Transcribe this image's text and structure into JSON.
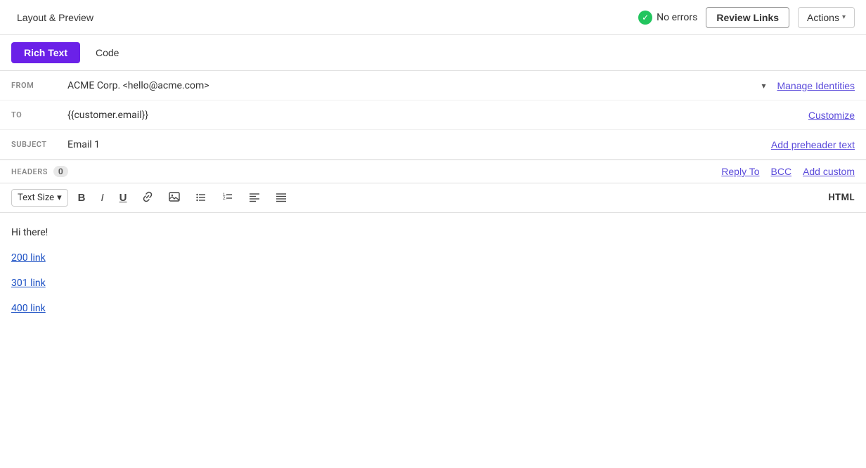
{
  "topbar": {
    "layout_preview_label": "Layout & Preview",
    "no_errors_label": "No errors",
    "review_links_label": "Review Links",
    "actions_label": "Actions"
  },
  "tabs": {
    "rich_text_label": "Rich Text",
    "code_label": "Code"
  },
  "from_field": {
    "label": "FROM",
    "value": "ACME Corp. <hello@acme.com>",
    "manage_identities_label": "Manage Identities"
  },
  "to_field": {
    "label": "TO",
    "value": "{{customer.email}}",
    "customize_label": "Customize"
  },
  "subject_field": {
    "label": "SUBJECT",
    "value": "Email 1",
    "add_preheader_label": "Add preheader text"
  },
  "headers": {
    "label": "HEADERS",
    "count": "0",
    "reply_to_label": "Reply To",
    "bcc_label": "BCC",
    "add_custom_label": "Add custom"
  },
  "toolbar": {
    "text_size_label": "Text Size",
    "bold_label": "B",
    "italic_label": "I",
    "underline_label": "U",
    "html_label": "HTML"
  },
  "editor": {
    "greeting": "Hi there!",
    "link_200": "200 link",
    "link_301": "301 link",
    "link_400": "400 link"
  }
}
